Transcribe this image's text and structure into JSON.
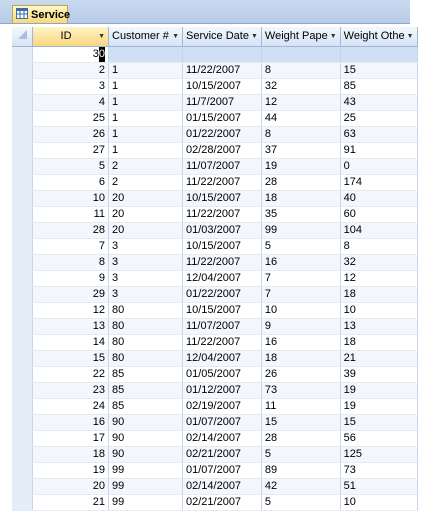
{
  "table_tab": {
    "label": "Service",
    "icon": "table-icon"
  },
  "columns": [
    {
      "label": "ID",
      "selected": true
    },
    {
      "label": "Customer #"
    },
    {
      "label": "Service Date"
    },
    {
      "label": "Weight Pape"
    },
    {
      "label": "Weight Othe"
    }
  ],
  "edit_row": {
    "id_prefix": "3",
    "id_caret": "0"
  },
  "rows": [
    [
      "2",
      "1",
      "11/22/2007",
      "8",
      "15"
    ],
    [
      "3",
      "1",
      "10/15/2007",
      "32",
      "85"
    ],
    [
      "4",
      "1",
      "11/7/2007",
      "12",
      "43"
    ],
    [
      "25",
      "1",
      "01/15/2007",
      "44",
      "25"
    ],
    [
      "26",
      "1",
      "01/22/2007",
      "8",
      "63"
    ],
    [
      "27",
      "1",
      "02/28/2007",
      "37",
      "91"
    ],
    [
      "5",
      "2",
      "11/07/2007",
      "19",
      "0"
    ],
    [
      "6",
      "2",
      "11/22/2007",
      "28",
      "174"
    ],
    [
      "10",
      "20",
      "10/15/2007",
      "18",
      "40"
    ],
    [
      "11",
      "20",
      "11/22/2007",
      "35",
      "60"
    ],
    [
      "28",
      "20",
      "01/03/2007",
      "99",
      "104"
    ],
    [
      "7",
      "3",
      "10/15/2007",
      "5",
      "8"
    ],
    [
      "8",
      "3",
      "11/22/2007",
      "16",
      "32"
    ],
    [
      "9",
      "3",
      "12/04/2007",
      "7",
      "12"
    ],
    [
      "29",
      "3",
      "01/22/2007",
      "7",
      "18"
    ],
    [
      "12",
      "80",
      "10/15/2007",
      "10",
      "10"
    ],
    [
      "13",
      "80",
      "11/07/2007",
      "9",
      "13"
    ],
    [
      "14",
      "80",
      "11/22/2007",
      "16",
      "18"
    ],
    [
      "15",
      "80",
      "12/04/2007",
      "18",
      "21"
    ],
    [
      "22",
      "85",
      "01/05/2007",
      "26",
      "39"
    ],
    [
      "23",
      "85",
      "01/12/2007",
      "73",
      "19"
    ],
    [
      "24",
      "85",
      "02/19/2007",
      "11",
      "19"
    ],
    [
      "16",
      "90",
      "01/07/2007",
      "15",
      "15"
    ],
    [
      "17",
      "90",
      "02/14/2007",
      "28",
      "56"
    ],
    [
      "18",
      "90",
      "02/21/2007",
      "5",
      "125"
    ],
    [
      "19",
      "99",
      "01/07/2007",
      "89",
      "73"
    ],
    [
      "20",
      "99",
      "02/14/2007",
      "42",
      "51"
    ],
    [
      "21",
      "99",
      "02/21/2007",
      "5",
      "10"
    ]
  ]
}
